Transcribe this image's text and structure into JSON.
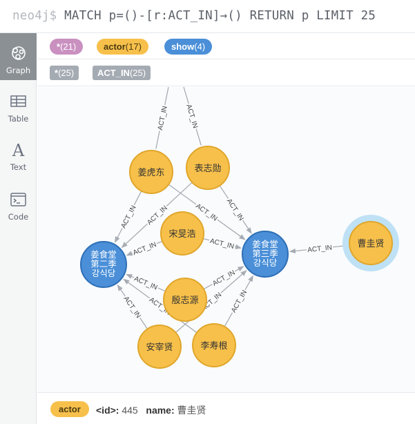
{
  "query": {
    "prompt": "neo4j$",
    "text": "MATCH p=()-[r:ACT_IN]→() RETURN p LIMIT 25"
  },
  "sidebar": {
    "items": [
      {
        "label": "Graph",
        "icon": "graph-icon"
      },
      {
        "label": "Table",
        "icon": "table-icon"
      },
      {
        "label": "Text",
        "icon": "text-icon"
      },
      {
        "label": "Code",
        "icon": "code-icon"
      }
    ]
  },
  "node_labels": {
    "all": {
      "name": "*",
      "count": "(21)",
      "color": "#c990c0"
    },
    "actor": {
      "name": "actor",
      "count": "(17)",
      "color": "#f7c04b"
    },
    "show": {
      "name": "show",
      "count": "(4)",
      "color": "#4a8fd8"
    }
  },
  "rel_types": {
    "all": {
      "name": "*",
      "count": "(25)"
    },
    "act_in": {
      "name": "ACT_IN",
      "count": "(25)"
    }
  },
  "graph": {
    "rel_label": "ACT_IN",
    "nodes": {
      "n1": "姜虎东",
      "n2": "表志勋",
      "n3": "宋旻浩",
      "n4": "殷志源",
      "n5": "安宰贤",
      "n6": "李寿根",
      "n7": "曹圭贤",
      "show_left": [
        "姜食堂",
        "第二季",
        "강식당"
      ],
      "show_right": [
        "姜食堂",
        "第三季",
        "강식당"
      ]
    }
  },
  "footer": {
    "label": "actor",
    "id_key": "<id>:",
    "id_value": "445",
    "name_key": "name:",
    "name_value": "曹圭贤"
  },
  "colors": {
    "actor_fill": "#f7c04b",
    "actor_stroke": "#e0a62a",
    "show_fill": "#4a8fd8",
    "show_stroke": "#2e6eb5",
    "edge": "#a7acb2",
    "selection_halo": "#bfe1f5"
  }
}
